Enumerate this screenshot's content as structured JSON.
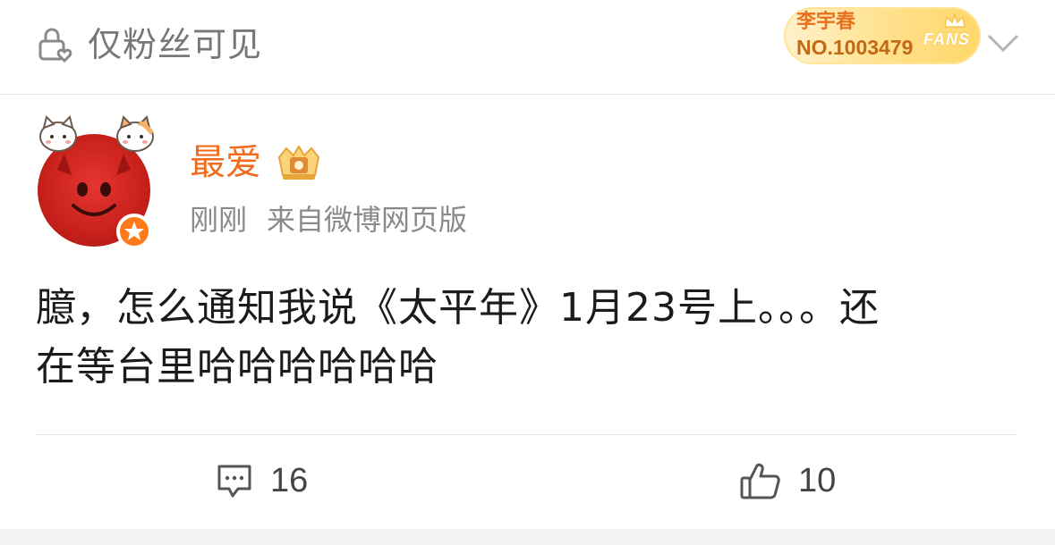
{
  "header": {
    "visibility_label": "仅粉丝可见",
    "fan_badge": {
      "name": "李宇春",
      "number": "NO.1003479",
      "fans_word": "FANS"
    }
  },
  "post": {
    "author": "最爱",
    "time": "刚刚",
    "source": "来自微博网页版",
    "text_line1": "臆，怎么通知我说《太平年》1月23号上。。。还",
    "text_line2": "在等台里哈哈哈哈哈哈"
  },
  "actions": {
    "comment_count": "16",
    "like_count": "10"
  },
  "colors": {
    "username": "#f26a1b",
    "meta": "#8a8a8a",
    "accent_badge": "#ffd76a"
  }
}
